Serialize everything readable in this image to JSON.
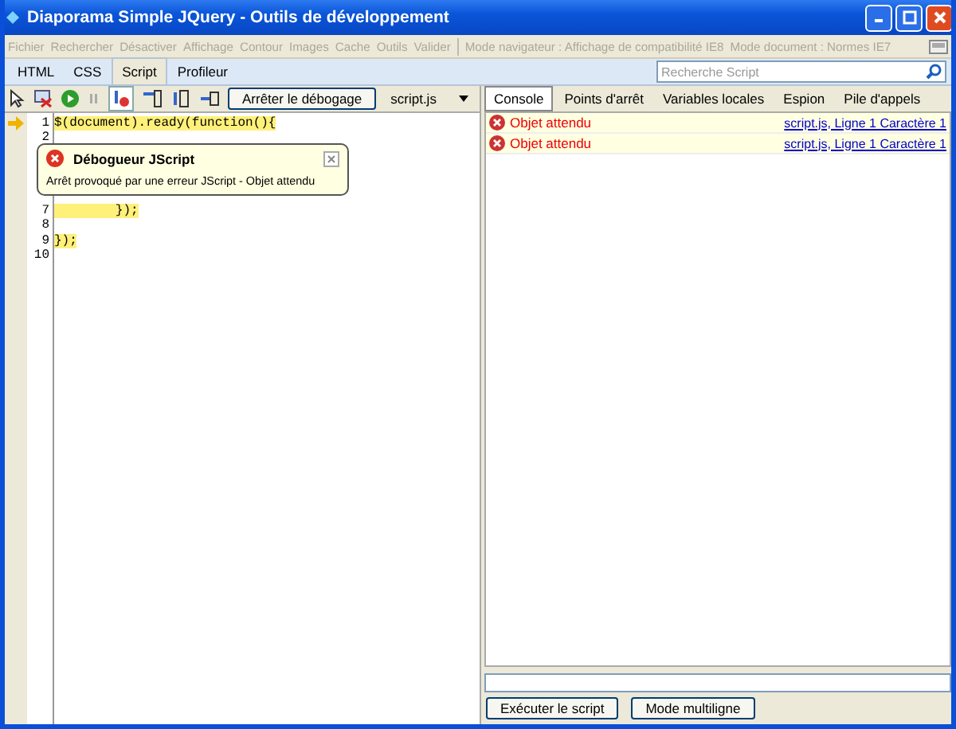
{
  "window": {
    "title": "Diaporama Simple JQuery - Outils de développement"
  },
  "menu": [
    {
      "label": "Fichier",
      "disabled": true
    },
    {
      "label": "Rechercher",
      "disabled": true
    },
    {
      "label": "Désactiver",
      "disabled": true
    },
    {
      "label": "Affichage",
      "disabled": true
    },
    {
      "label": "Contour",
      "disabled": true
    },
    {
      "label": "Images",
      "disabled": true
    },
    {
      "label": "Cache",
      "disabled": true
    },
    {
      "label": "Outils",
      "disabled": true
    },
    {
      "label": "Valider",
      "disabled": true
    }
  ],
  "modes": [
    {
      "label": "Mode navigateur : Affichage de compatibilité IE8",
      "disabled": true
    },
    {
      "label": "Mode document : Normes IE7",
      "disabled": true
    }
  ],
  "tabs": [
    {
      "label": "HTML",
      "selected": false
    },
    {
      "label": "CSS",
      "selected": false
    },
    {
      "label": "Script",
      "selected": true
    },
    {
      "label": "Profileur",
      "selected": false
    }
  ],
  "search": {
    "placeholder": "Recherche Script"
  },
  "toolbar": {
    "stop_button": "Arrêter le débogage",
    "file": "script.js"
  },
  "code": {
    "lines_before": [
      {
        "number": "1",
        "text": "$(document).ready(function(){"
      },
      {
        "number": "2"
      }
    ],
    "lines_after": [
      {
        "number": "7",
        "text": "        });"
      },
      {
        "number": "8"
      },
      {
        "number": "9",
        "text": "});"
      },
      {
        "number": "10"
      }
    ]
  },
  "callout": {
    "title": "Débogueur JScript",
    "message": "Arrêt provoqué par une erreur JScript - Objet attendu"
  },
  "console_tabs": [
    {
      "label": "Console",
      "selected": true
    },
    {
      "label": "Points d'arrêt",
      "selected": false
    },
    {
      "label": "Variables locales",
      "selected": false
    },
    {
      "label": "Espion",
      "selected": false
    },
    {
      "label": "Pile d'appels",
      "selected": false
    }
  ],
  "messages": [
    {
      "text": "Objet attendu",
      "link": "script.js, Ligne 1 Caractère 1"
    },
    {
      "text": "Objet attendu",
      "link": "script.js, Ligne 1 Caractère 1"
    }
  ],
  "buttons": [
    "Exécuter le script",
    "Mode multiligne"
  ]
}
